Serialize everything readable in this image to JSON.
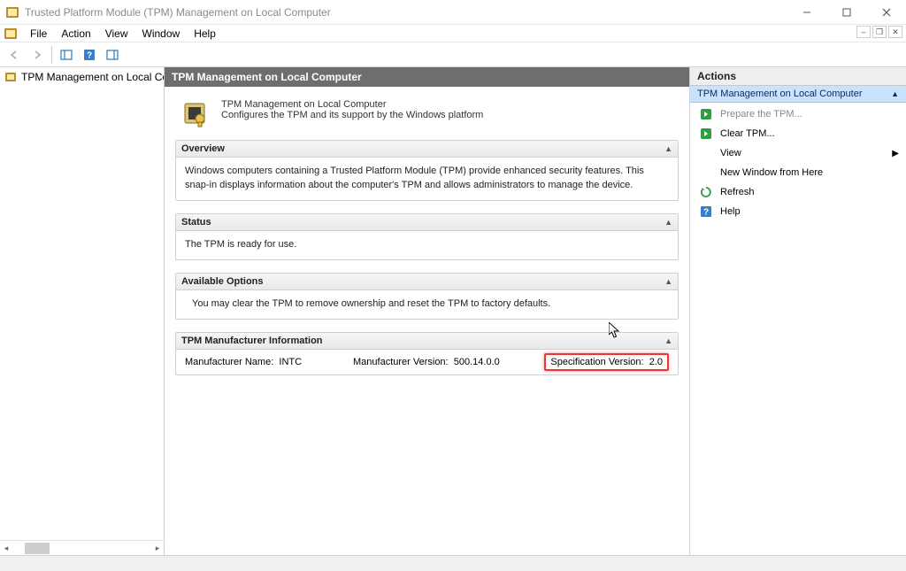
{
  "window": {
    "title": "Trusted Platform Module (TPM) Management on Local Computer"
  },
  "menu": {
    "file": "File",
    "action": "Action",
    "view": "View",
    "window": "Window",
    "help": "Help"
  },
  "tree": {
    "root": "TPM Management on Local Comp"
  },
  "content": {
    "header": "TPM Management on Local Computer",
    "intro_title": "TPM Management on Local Computer",
    "intro_desc": "Configures the TPM and its support by the Windows platform",
    "overview": {
      "title": "Overview",
      "text": "Windows computers containing a Trusted Platform Module (TPM) provide enhanced security features. This snap-in displays information about the computer's TPM and allows administrators to manage the device."
    },
    "status": {
      "title": "Status",
      "text": "The TPM is ready for use."
    },
    "options": {
      "title": "Available Options",
      "text": "You may clear the TPM to remove ownership and reset the TPM to factory defaults."
    },
    "manufacturer": {
      "title": "TPM Manufacturer Information",
      "name_label": "Manufacturer Name:",
      "name_value": "INTC",
      "version_label": "Manufacturer Version:",
      "version_value": "500.14.0.0",
      "spec_label": "Specification Version:",
      "spec_value": "2.0"
    }
  },
  "actions": {
    "header": "Actions",
    "group_title": "TPM Management on Local Computer",
    "prepare": "Prepare the TPM...",
    "clear": "Clear TPM...",
    "view": "View",
    "new_window": "New Window from Here",
    "refresh": "Refresh",
    "help": "Help"
  }
}
